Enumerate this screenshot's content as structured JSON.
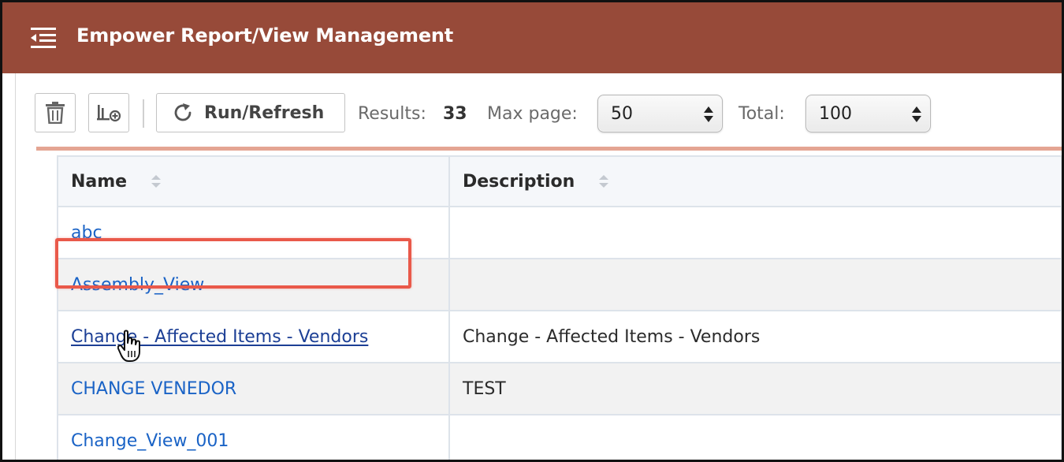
{
  "header": {
    "title": "Empower Report/View Management",
    "background_color": "#974a39",
    "menu_icon": "collapse-menu-icon"
  },
  "toolbar": {
    "delete_icon": "trash-icon",
    "chart_icon": "add-chart-icon",
    "run_refresh_label": "Run/Refresh",
    "run_refresh_icon": "refresh-icon",
    "results_label": "Results:",
    "results_count": "33",
    "max_page_label": "Max page:",
    "max_page_value": "50",
    "total_label": "Total:",
    "total_value": "100"
  },
  "table": {
    "columns": [
      {
        "label": "Name",
        "sortable": true
      },
      {
        "label": "Description",
        "sortable": true
      }
    ],
    "rows": [
      {
        "name": "abc",
        "description": ""
      },
      {
        "name": "Assembly_View",
        "description": ""
      },
      {
        "name": "Change - Affected Items - Vendors",
        "description": "Change - Affected Items - Vendors",
        "highlighted": true,
        "hovered": true
      },
      {
        "name": "CHANGE VENEDOR",
        "description": "TEST"
      },
      {
        "name": "Change_View_001",
        "description": ""
      }
    ]
  },
  "colors": {
    "link": "#1a63c6",
    "link_hover": "#1c3f95",
    "highlight_border": "#e9594a",
    "accent_line": "#e4a593"
  }
}
